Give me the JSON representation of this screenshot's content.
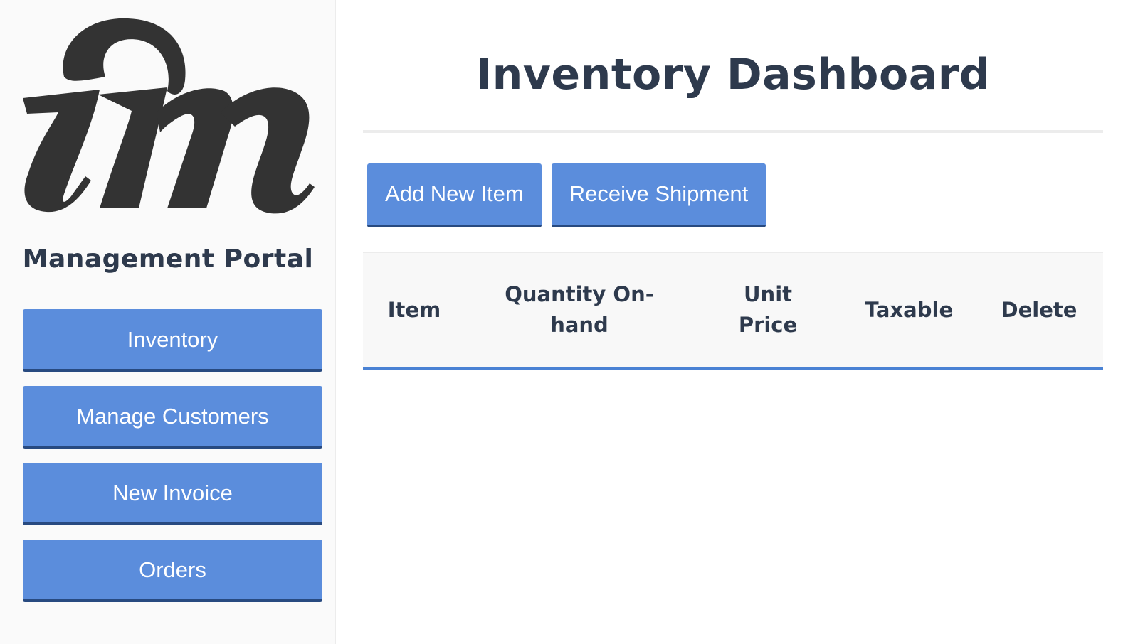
{
  "sidebar": {
    "logo_text": "im",
    "portal_title": "Management Portal",
    "nav": [
      {
        "label": "Inventory"
      },
      {
        "label": "Manage Customers"
      },
      {
        "label": "New Invoice"
      },
      {
        "label": "Orders"
      }
    ]
  },
  "main": {
    "title": "Inventory Dashboard",
    "actions": {
      "add_item": "Add New Item",
      "receive_shipment": "Receive Shipment"
    },
    "table": {
      "columns": [
        "Item",
        "Quantity On-hand",
        "Unit Price",
        "Taxable",
        "Delete"
      ],
      "rows": []
    }
  },
  "colors": {
    "button_bg": "#5b8ddc",
    "button_border": "#284a80",
    "heading_text": "#2e3a4d",
    "table_accent": "#4a82d4"
  }
}
